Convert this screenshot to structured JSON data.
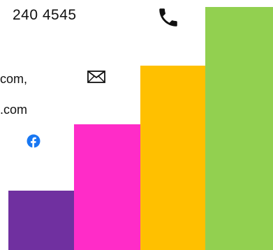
{
  "contact": {
    "phone_text": "240 4545",
    "email_line_1": "com,",
    "email_line_2": ".com"
  },
  "icons": {
    "phone": "phone-icon",
    "mail": "envelope-icon",
    "social": "facebook-icon"
  },
  "decor": {
    "bars": [
      {
        "name": "purple",
        "color": "#7030A0"
      },
      {
        "name": "pink",
        "color": "#FF2CC8"
      },
      {
        "name": "orange",
        "color": "#FFC000"
      },
      {
        "name": "green",
        "color": "#92D050"
      }
    ]
  },
  "colors": {
    "text": "#111111",
    "facebook_blue": "#1877F2"
  }
}
